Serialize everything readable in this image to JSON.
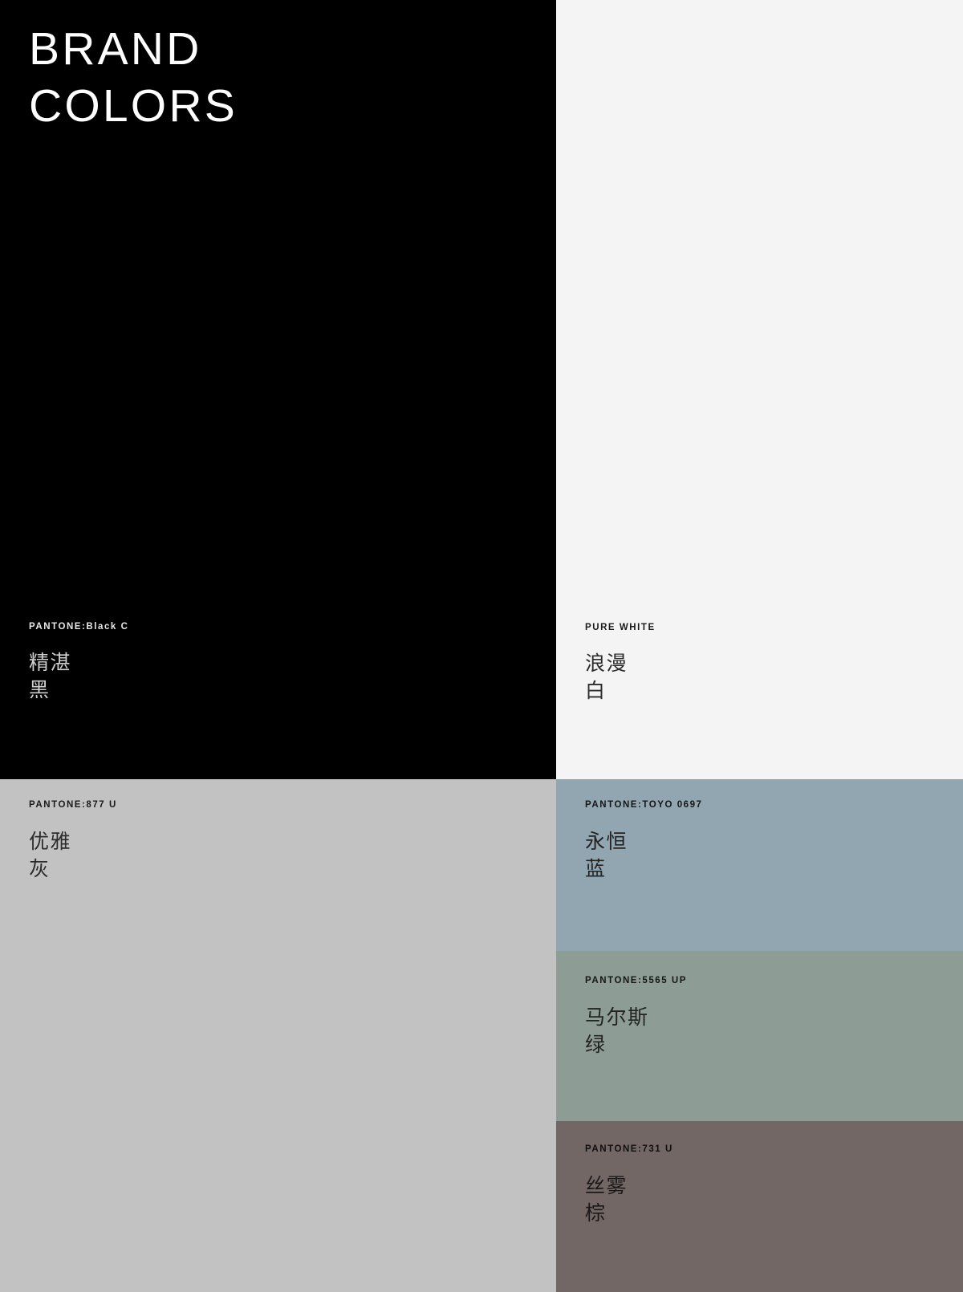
{
  "headline": {
    "line1": "BRAND",
    "line2": "COLORS",
    "text": "BRAND\nCOLORS"
  },
  "palette": {
    "swatches": [
      {
        "id": "black",
        "code": "PANTONE:Black C",
        "name_line1": "精湛",
        "name_line2": "黑",
        "hex": "#000000",
        "label_color": "#e8e8e8"
      },
      {
        "id": "white",
        "code": "PURE WHITE",
        "name_line1": "浪漫",
        "name_line2": "白",
        "hex": "#f4f4f4",
        "label_color": "#1b1b1b"
      },
      {
        "id": "gray",
        "code": "PANTONE:877 U",
        "name_line1": "优雅",
        "name_line2": "灰",
        "hex": "#c2c2c2",
        "label_color": "#1b1b1b"
      },
      {
        "id": "blue",
        "code": "PANTONE:TOYO 0697",
        "name_line1": "永恒",
        "name_line2": "蓝",
        "hex": "#92a6b1",
        "label_color": "#161616"
      },
      {
        "id": "green",
        "code": "PANTONE:5565 UP",
        "name_line1": "马尔斯",
        "name_line2": "绿",
        "hex": "#8d9d95",
        "label_color": "#161616"
      },
      {
        "id": "brown",
        "code": "PANTONE:731 U",
        "name_line1": "丝雾",
        "name_line2": "棕",
        "hex": "#736765",
        "label_color": "#100f0f"
      }
    ]
  }
}
